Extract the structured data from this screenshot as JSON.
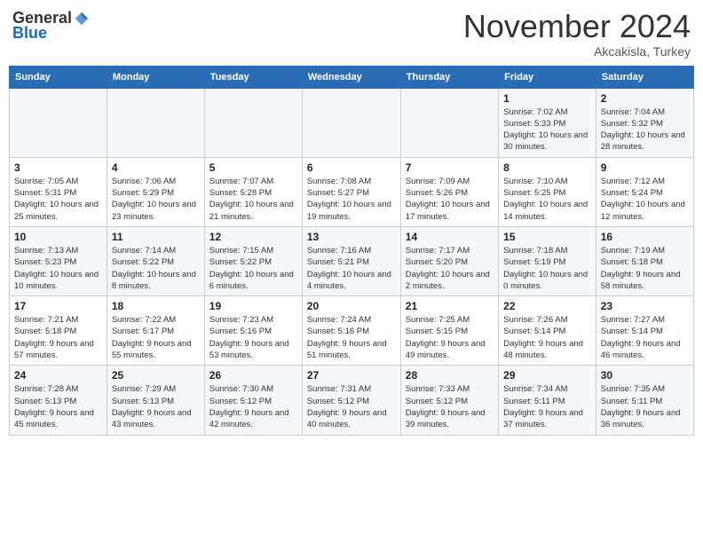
{
  "header": {
    "logo_general": "General",
    "logo_blue": "Blue",
    "month": "November 2024",
    "location": "Akcakisla, Turkey"
  },
  "weekdays": [
    "Sunday",
    "Monday",
    "Tuesday",
    "Wednesday",
    "Thursday",
    "Friday",
    "Saturday"
  ],
  "weeks": [
    [
      {
        "day": "",
        "info": ""
      },
      {
        "day": "",
        "info": ""
      },
      {
        "day": "",
        "info": ""
      },
      {
        "day": "",
        "info": ""
      },
      {
        "day": "",
        "info": ""
      },
      {
        "day": "1",
        "info": "Sunrise: 7:02 AM\nSunset: 5:33 PM\nDaylight: 10 hours and 30 minutes."
      },
      {
        "day": "2",
        "info": "Sunrise: 7:04 AM\nSunset: 5:32 PM\nDaylight: 10 hours and 28 minutes."
      }
    ],
    [
      {
        "day": "3",
        "info": "Sunrise: 7:05 AM\nSunset: 5:31 PM\nDaylight: 10 hours and 25 minutes."
      },
      {
        "day": "4",
        "info": "Sunrise: 7:06 AM\nSunset: 5:29 PM\nDaylight: 10 hours and 23 minutes."
      },
      {
        "day": "5",
        "info": "Sunrise: 7:07 AM\nSunset: 5:28 PM\nDaylight: 10 hours and 21 minutes."
      },
      {
        "day": "6",
        "info": "Sunrise: 7:08 AM\nSunset: 5:27 PM\nDaylight: 10 hours and 19 minutes."
      },
      {
        "day": "7",
        "info": "Sunrise: 7:09 AM\nSunset: 5:26 PM\nDaylight: 10 hours and 17 minutes."
      },
      {
        "day": "8",
        "info": "Sunrise: 7:10 AM\nSunset: 5:25 PM\nDaylight: 10 hours and 14 minutes."
      },
      {
        "day": "9",
        "info": "Sunrise: 7:12 AM\nSunset: 5:24 PM\nDaylight: 10 hours and 12 minutes."
      }
    ],
    [
      {
        "day": "10",
        "info": "Sunrise: 7:13 AM\nSunset: 5:23 PM\nDaylight: 10 hours and 10 minutes."
      },
      {
        "day": "11",
        "info": "Sunrise: 7:14 AM\nSunset: 5:22 PM\nDaylight: 10 hours and 8 minutes."
      },
      {
        "day": "12",
        "info": "Sunrise: 7:15 AM\nSunset: 5:22 PM\nDaylight: 10 hours and 6 minutes."
      },
      {
        "day": "13",
        "info": "Sunrise: 7:16 AM\nSunset: 5:21 PM\nDaylight: 10 hours and 4 minutes."
      },
      {
        "day": "14",
        "info": "Sunrise: 7:17 AM\nSunset: 5:20 PM\nDaylight: 10 hours and 2 minutes."
      },
      {
        "day": "15",
        "info": "Sunrise: 7:18 AM\nSunset: 5:19 PM\nDaylight: 10 hours and 0 minutes."
      },
      {
        "day": "16",
        "info": "Sunrise: 7:19 AM\nSunset: 5:18 PM\nDaylight: 9 hours and 58 minutes."
      }
    ],
    [
      {
        "day": "17",
        "info": "Sunrise: 7:21 AM\nSunset: 5:18 PM\nDaylight: 9 hours and 57 minutes."
      },
      {
        "day": "18",
        "info": "Sunrise: 7:22 AM\nSunset: 5:17 PM\nDaylight: 9 hours and 55 minutes."
      },
      {
        "day": "19",
        "info": "Sunrise: 7:23 AM\nSunset: 5:16 PM\nDaylight: 9 hours and 53 minutes."
      },
      {
        "day": "20",
        "info": "Sunrise: 7:24 AM\nSunset: 5:16 PM\nDaylight: 9 hours and 51 minutes."
      },
      {
        "day": "21",
        "info": "Sunrise: 7:25 AM\nSunset: 5:15 PM\nDaylight: 9 hours and 49 minutes."
      },
      {
        "day": "22",
        "info": "Sunrise: 7:26 AM\nSunset: 5:14 PM\nDaylight: 9 hours and 48 minutes."
      },
      {
        "day": "23",
        "info": "Sunrise: 7:27 AM\nSunset: 5:14 PM\nDaylight: 9 hours and 46 minutes."
      }
    ],
    [
      {
        "day": "24",
        "info": "Sunrise: 7:28 AM\nSunset: 5:13 PM\nDaylight: 9 hours and 45 minutes."
      },
      {
        "day": "25",
        "info": "Sunrise: 7:29 AM\nSunset: 5:13 PM\nDaylight: 9 hours and 43 minutes."
      },
      {
        "day": "26",
        "info": "Sunrise: 7:30 AM\nSunset: 5:12 PM\nDaylight: 9 hours and 42 minutes."
      },
      {
        "day": "27",
        "info": "Sunrise: 7:31 AM\nSunset: 5:12 PM\nDaylight: 9 hours and 40 minutes."
      },
      {
        "day": "28",
        "info": "Sunrise: 7:33 AM\nSunset: 5:12 PM\nDaylight: 9 hours and 39 minutes."
      },
      {
        "day": "29",
        "info": "Sunrise: 7:34 AM\nSunset: 5:11 PM\nDaylight: 9 hours and 37 minutes."
      },
      {
        "day": "30",
        "info": "Sunrise: 7:35 AM\nSunset: 5:11 PM\nDaylight: 9 hours and 36 minutes."
      }
    ]
  ]
}
